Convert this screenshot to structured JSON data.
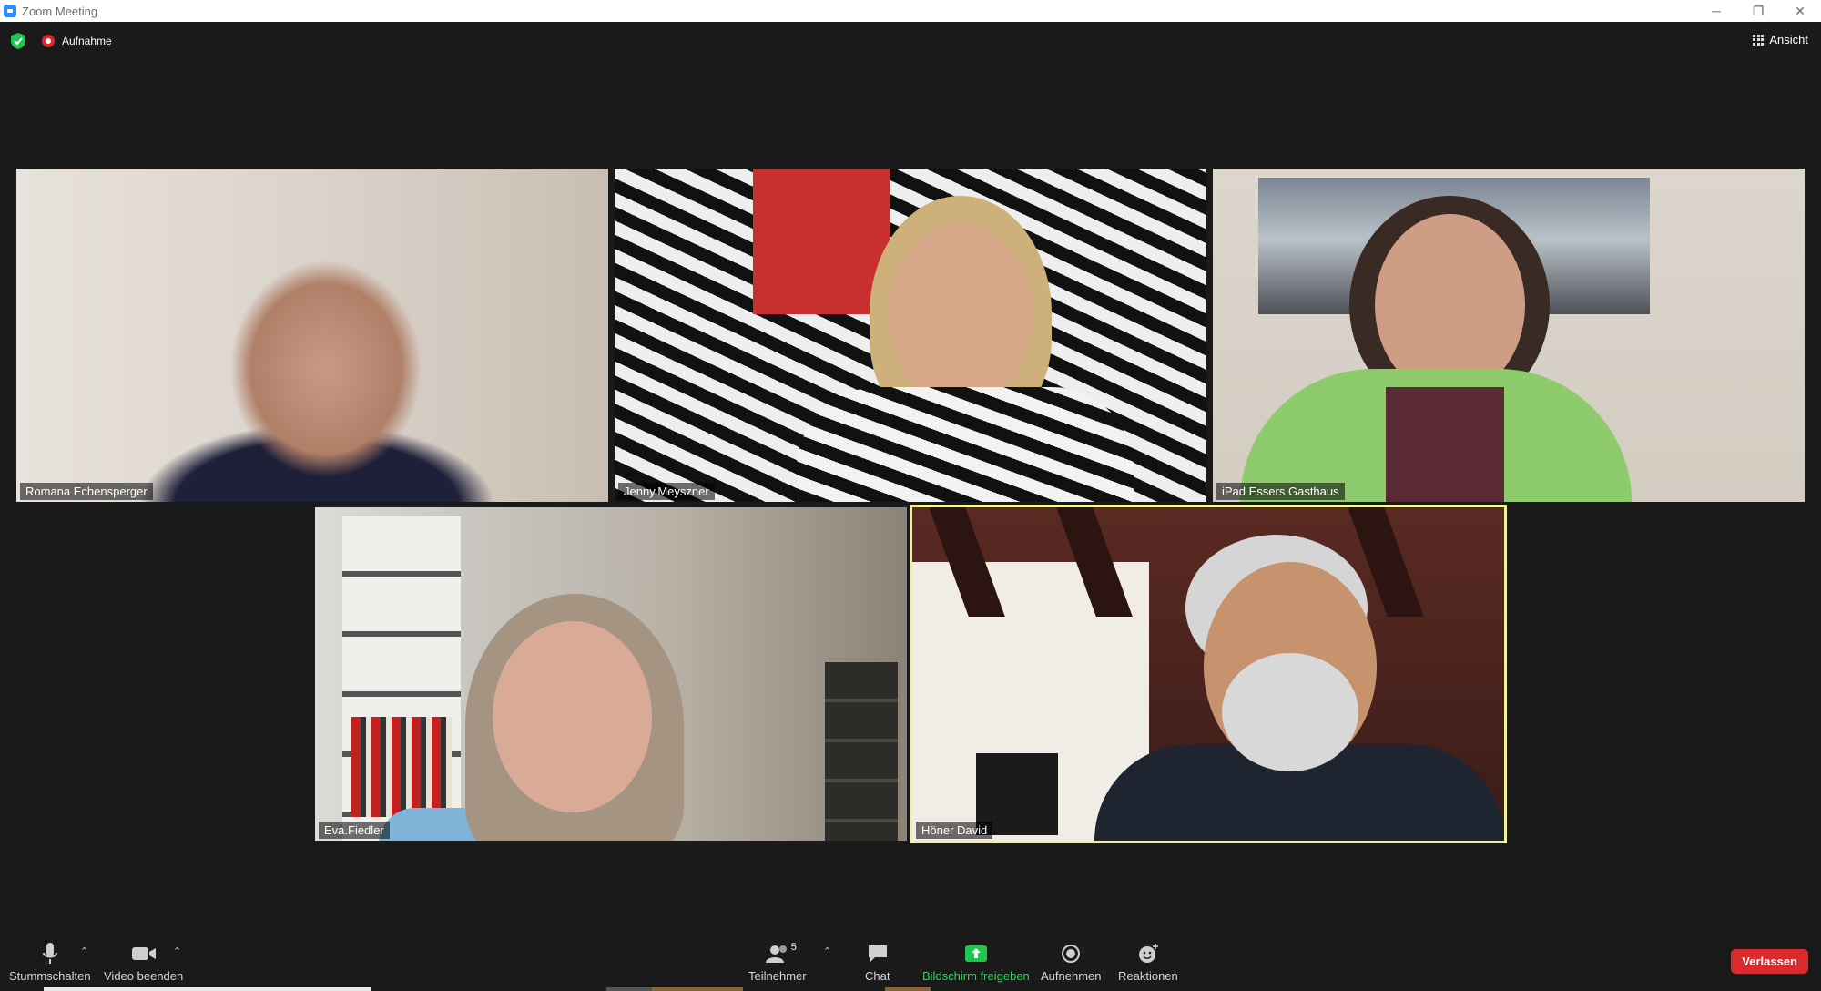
{
  "window": {
    "title": "Zoom Meeting",
    "controls": {
      "minimize": "─",
      "restore": "❐",
      "close": "✕"
    }
  },
  "topbar": {
    "recording_label": "Aufnahme",
    "view_label": "Ansicht"
  },
  "participants": [
    {
      "name": "Romana Echensperger",
      "active_speaker": false
    },
    {
      "name": "Jenny.Meyszner",
      "active_speaker": false
    },
    {
      "name": "iPad Essers Gasthaus",
      "active_speaker": false
    },
    {
      "name": "Eva.Fiedler",
      "active_speaker": false
    },
    {
      "name": "Höner David",
      "active_speaker": true
    }
  ],
  "toolbar": {
    "mute_label": "Stummschalten",
    "video_label": "Video beenden",
    "participants_label": "Teilnehmer",
    "participants_count": "5",
    "chat_label": "Chat",
    "share_label": "Bildschirm freigeben",
    "record_label": "Aufnehmen",
    "reactions_label": "Reaktionen",
    "leave_label": "Verlassen"
  },
  "colors": {
    "share_green": "#23d959",
    "leave_red": "#d92b2b",
    "active_speaker_border": "#f2f29a",
    "background": "#1a1a1a"
  }
}
